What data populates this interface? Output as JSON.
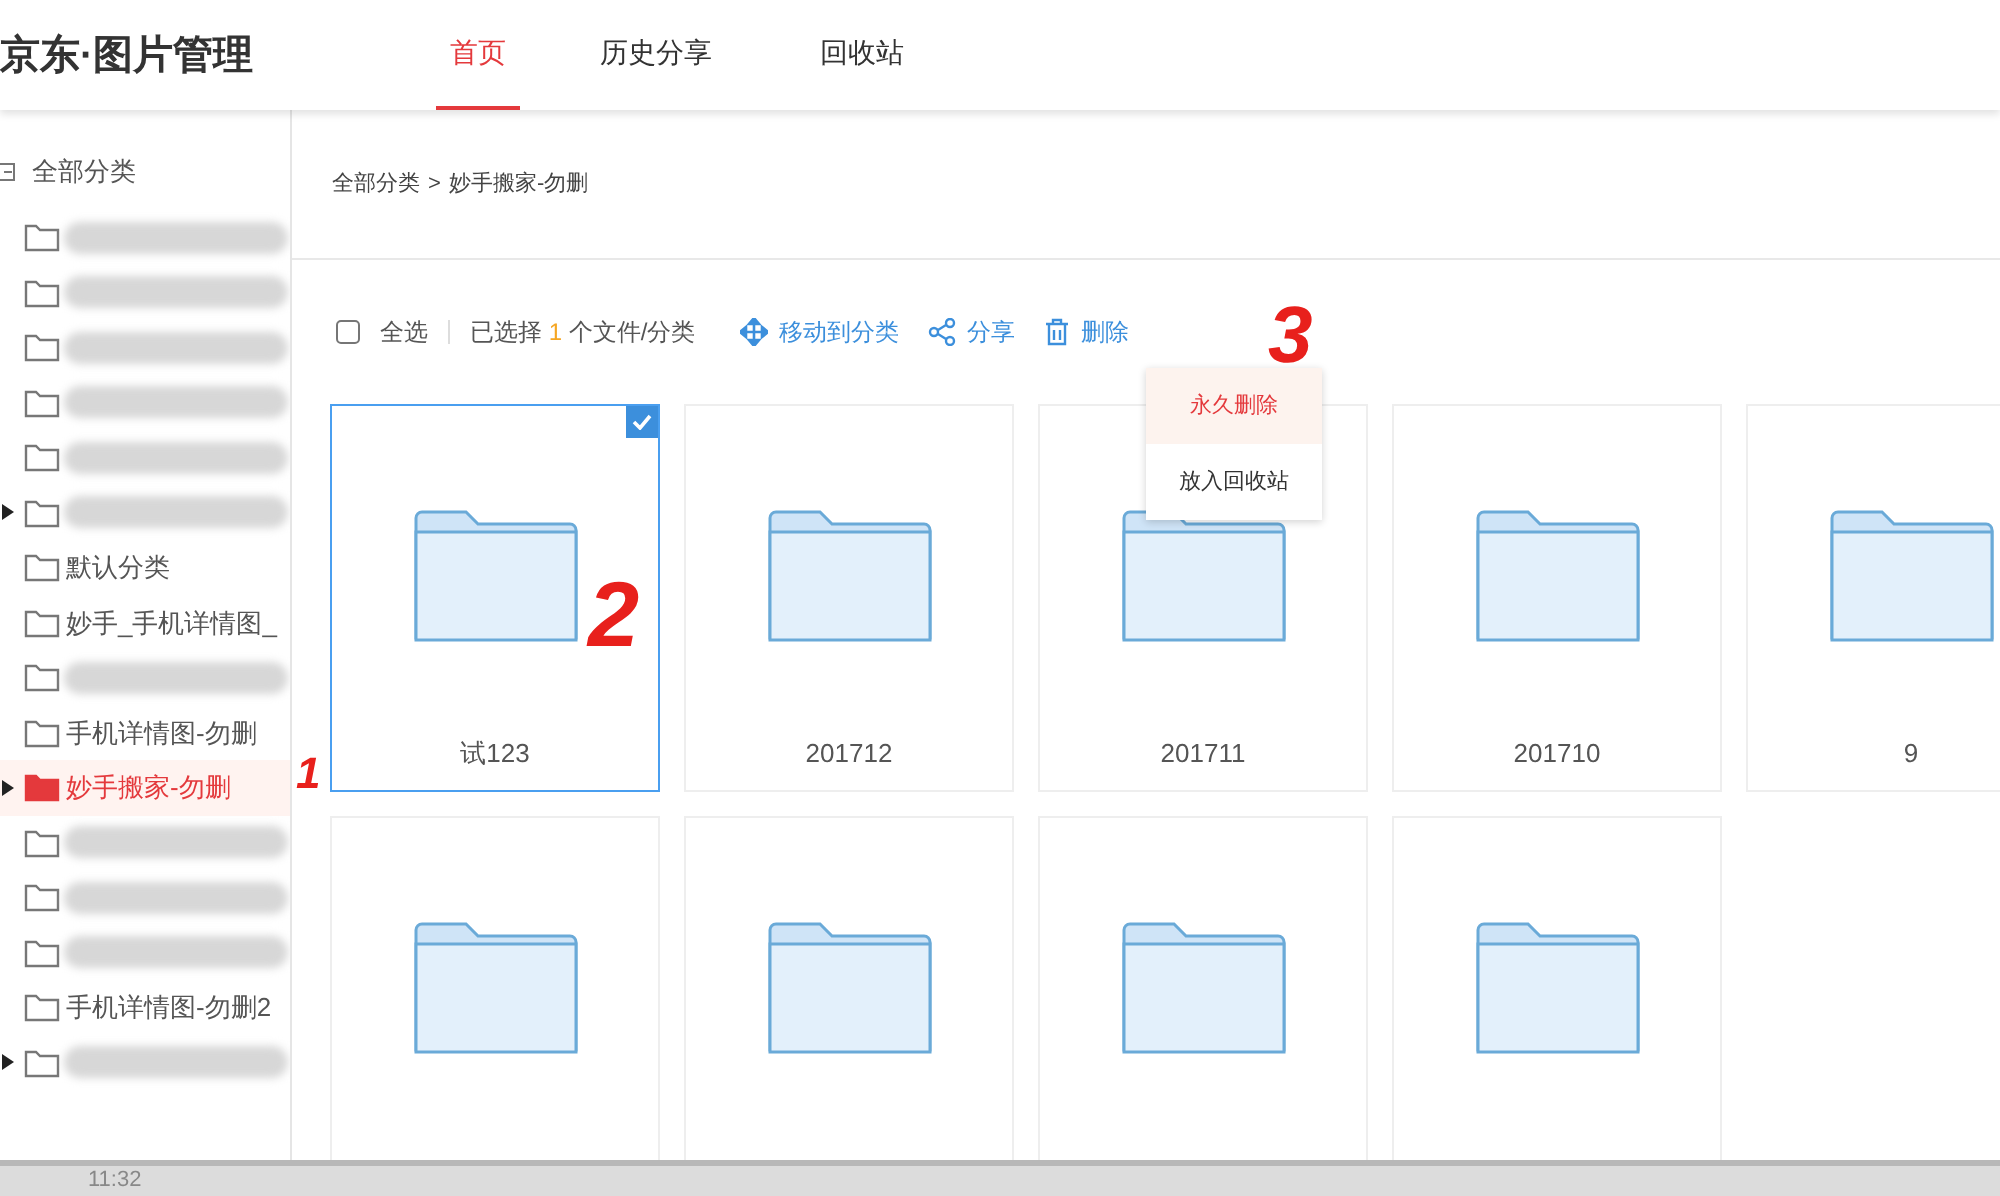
{
  "header": {
    "logo": "京东·图片管理",
    "tabs": [
      {
        "label": "首页",
        "selected": true
      },
      {
        "label": "历史分享",
        "selected": false
      },
      {
        "label": "回收站",
        "selected": false
      }
    ]
  },
  "sidebar": {
    "root": "全部分类",
    "items": [
      {
        "kind": "blurred",
        "expandable": false,
        "selected": false
      },
      {
        "kind": "blurred",
        "expandable": false,
        "selected": false
      },
      {
        "kind": "blurred",
        "expandable": false,
        "selected": false
      },
      {
        "kind": "blurred",
        "expandable": false,
        "selected": false
      },
      {
        "kind": "blurred",
        "expandable": false,
        "selected": false
      },
      {
        "kind": "blurred",
        "expandable": true,
        "selected": false
      },
      {
        "kind": "folder",
        "label": "默认分类",
        "expandable": false,
        "selected": false
      },
      {
        "kind": "folder",
        "label": "妙手_手机详情图_",
        "expandable": false,
        "selected": false
      },
      {
        "kind": "blurred",
        "expandable": false,
        "selected": false
      },
      {
        "kind": "folder",
        "label": "手机详情图-勿删",
        "expandable": false,
        "selected": false
      },
      {
        "kind": "folder",
        "label": "妙手搬家-勿删",
        "expandable": true,
        "selected": true
      },
      {
        "kind": "blurred",
        "expandable": false,
        "selected": false
      },
      {
        "kind": "blurred",
        "expandable": false,
        "selected": false
      },
      {
        "kind": "blurred",
        "expandable": false,
        "selected": false
      },
      {
        "kind": "folder",
        "label": "手机详情图-勿删2",
        "expandable": false,
        "selected": false
      },
      {
        "kind": "blurred",
        "expandable": true,
        "selected": false
      }
    ]
  },
  "breadcrumb": [
    "全部分类",
    ">",
    "妙手搬家-勿删"
  ],
  "toolbar": {
    "select_all": {
      "label": "全选",
      "checked": false
    },
    "selected_prefix": "已选择",
    "selected_count": "1",
    "selected_suffix": "个文件/分类",
    "actions": [
      {
        "kind": "move",
        "label": "移动到分类"
      },
      {
        "kind": "share",
        "label": "分享"
      },
      {
        "kind": "delete",
        "label": "删除"
      }
    ],
    "delete_menu": [
      {
        "label": "永久删除",
        "selected": true
      },
      {
        "label": "放入回收站",
        "selected": false
      }
    ]
  },
  "folders": [
    {
      "name": "试123",
      "selected": true
    },
    {
      "name": "201712",
      "selected": false
    },
    {
      "name": "201711",
      "selected": false
    },
    {
      "name": "201710",
      "selected": false
    },
    {
      "name": "9",
      "selected": false
    },
    {
      "selected": false
    },
    {
      "selected": false
    },
    {
      "selected": false
    },
    {
      "selected": false
    }
  ],
  "annotations": [
    "1",
    "2",
    "3"
  ],
  "taskbar": {
    "time": "11:32"
  }
}
